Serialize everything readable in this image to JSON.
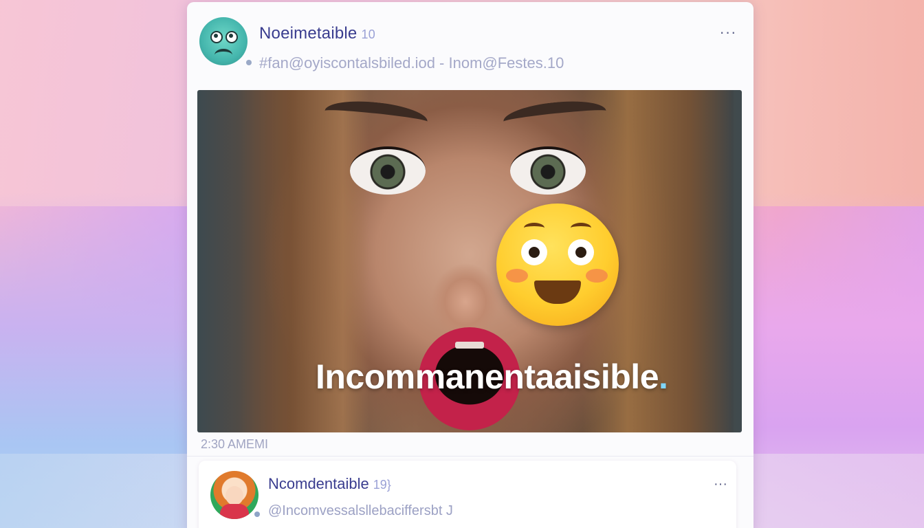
{
  "post": {
    "username": "Noeimetaible",
    "badge": "10",
    "handle": "#fan@oyiscontalsbiled.iod - Inom@Festes.10",
    "more_icon": "more-horizontal-icon",
    "more_label": "···",
    "overlay_text": "Incommanentaaisible",
    "overlay_dot": ".",
    "emoji": "flushed-face-emoji",
    "timestamp": "2:30 AMEMI"
  },
  "reply": {
    "username": "Ncomdentaible",
    "badge": "19}",
    "handle": "@Incomvessalsllebaciffersbt J",
    "more_label": "···"
  },
  "colors": {
    "username": "#3a3d8f",
    "handle": "#a4a8c8",
    "emoji_yellow": "#ffcd2e",
    "lip_red": "#c3224a"
  }
}
